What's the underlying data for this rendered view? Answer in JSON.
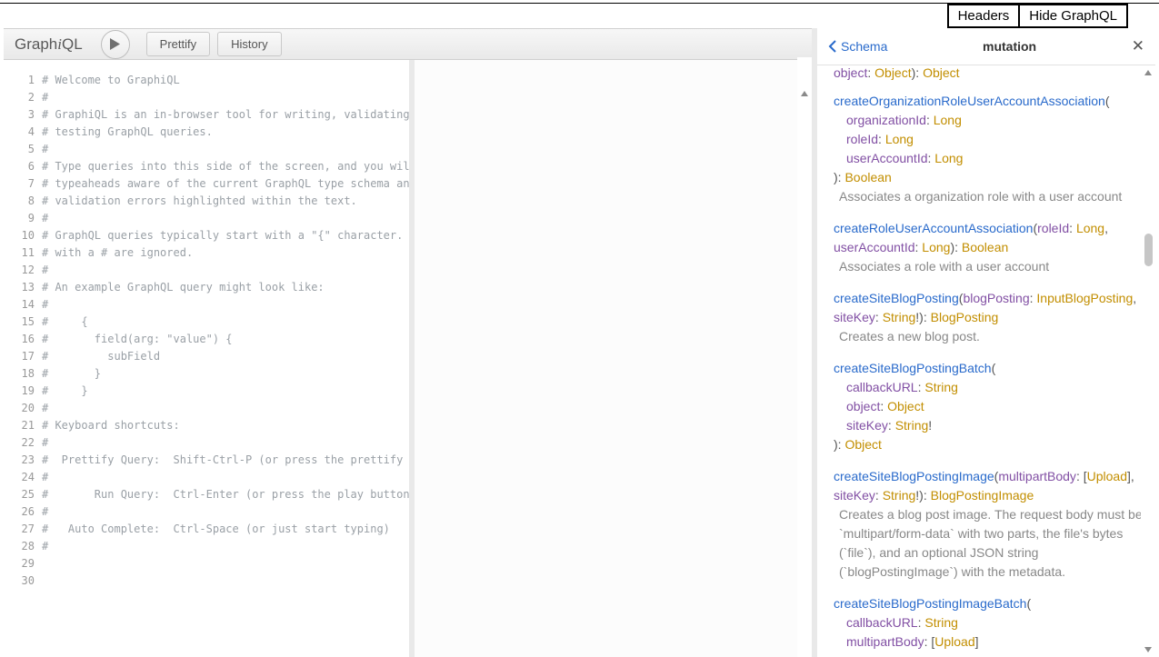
{
  "top_buttons": {
    "headers": "Headers",
    "hide_graphql": "Hide GraphQL"
  },
  "topbar": {
    "logo_parts": [
      "Graph",
      "i",
      "QL"
    ],
    "prettify": "Prettify",
    "history": "History"
  },
  "editor": {
    "lines": [
      "# Welcome to GraphiQL",
      "#",
      "# GraphiQL is an in-browser tool for writing, validating, and",
      "# testing GraphQL queries.",
      "#",
      "# Type queries into this side of the screen, and you will see",
      "# typeaheads aware of the current GraphQL type schema and live",
      "# validation errors highlighted within the text.",
      "#",
      "# GraphQL queries typically start with a \"{\" character. Lines",
      "# with a # are ignored.",
      "#",
      "# An example GraphQL query might look like:",
      "#",
      "#     {",
      "#       field(arg: \"value\") {",
      "#         subField",
      "#       }",
      "#     }",
      "#",
      "# Keyboard shortcuts:",
      "#",
      "#  Prettify Query:  Shift-Ctrl-P (or press the prettify button",
      "#",
      "#       Run Query:  Ctrl-Enter (or press the play button above",
      "#",
      "#   Auto Complete:  Ctrl-Space (or just start typing)",
      "#",
      "",
      ""
    ],
    "line_count": 30
  },
  "doc": {
    "back_label": "Schema",
    "title": "mutation",
    "partial_top": {
      "arg": "object",
      "type": "Object",
      "ret": "Object"
    },
    "entry1": {
      "name": "createOrganizationRoleUserAccountAssociation",
      "args": [
        {
          "name": "organizationId",
          "type": "Long"
        },
        {
          "name": "roleId",
          "type": "Long"
        },
        {
          "name": "userAccountId",
          "type": "Long"
        }
      ],
      "ret": "Boolean",
      "desc": "Associates a organization role with a user account"
    },
    "entry2": {
      "name": "createRoleUserAccountAssociation",
      "arg1": {
        "name": "roleId",
        "type": "Long"
      },
      "arg2": {
        "name": "userAccountId",
        "type": "Long"
      },
      "ret": "Boolean",
      "desc": "Associates a role with a user account"
    },
    "entry3": {
      "name": "createSiteBlogPosting",
      "arg1": {
        "name": "blogPosting",
        "type": "InputBlogPosting"
      },
      "arg2": {
        "name": "siteKey",
        "type": "String"
      },
      "ret": "BlogPosting",
      "desc": "Creates a new blog post."
    },
    "entry4": {
      "name": "createSiteBlogPostingBatch",
      "args": [
        {
          "name": "callbackURL",
          "type": "String"
        },
        {
          "name": "object",
          "type": "Object"
        },
        {
          "name": "siteKey",
          "type": "String",
          "nn": true
        }
      ],
      "ret": "Object"
    },
    "entry5": {
      "name": "createSiteBlogPostingImage",
      "arg1": {
        "name": "multipartBody",
        "type": "Upload",
        "list": true
      },
      "arg2": {
        "name": "siteKey",
        "type": "String",
        "nn": true
      },
      "ret": "BlogPostingImage",
      "desc": "Creates a blog post image. The request body must be `multipart/form-data` with two parts, the file's bytes (`file`), and an optional JSON string (`blogPostingImage`) with the metadata."
    },
    "entry6": {
      "name": "createSiteBlogPostingImageBatch",
      "args": [
        {
          "name": "callbackURL",
          "type": "String"
        },
        {
          "name": "multipartBody",
          "type": "Upload",
          "list": true
        }
      ]
    }
  }
}
